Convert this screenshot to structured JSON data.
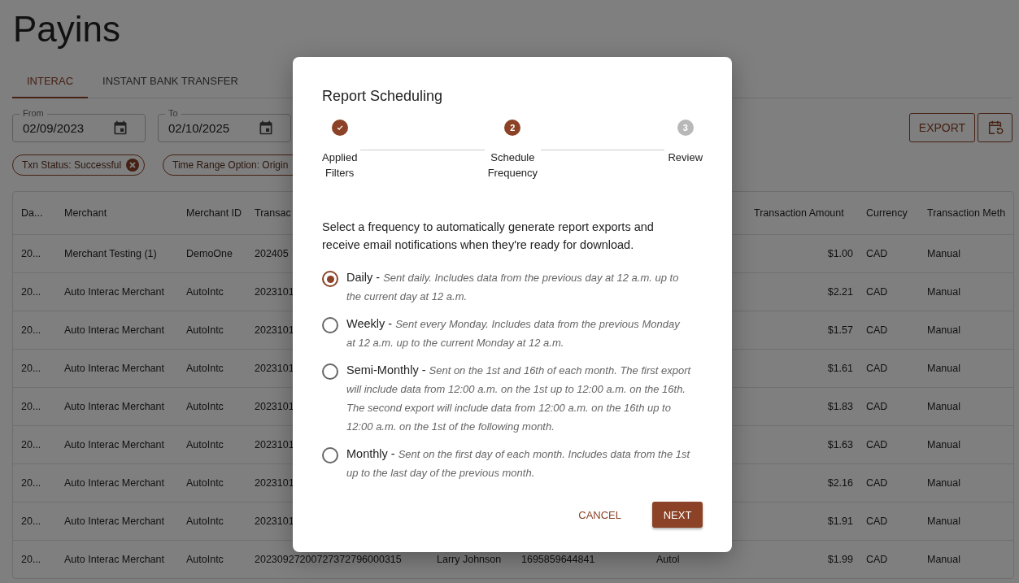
{
  "page": {
    "title": "Payins"
  },
  "tabs": [
    {
      "label": "INTERAC",
      "selected": true
    },
    {
      "label": "INSTANT BANK TRANSFER",
      "selected": false
    }
  ],
  "date_fields": [
    {
      "label": "From",
      "value": "02/09/2023"
    },
    {
      "label": "To",
      "value": "02/10/2025"
    }
  ],
  "filter_chips": [
    {
      "label": "Txn Status: Successful",
      "removable": true
    },
    {
      "label": "Time Range Option: Origin",
      "removable": false
    }
  ],
  "toolbar": {
    "export_button": "EXPORT"
  },
  "table": {
    "columns": [
      "Da...",
      "Merchant",
      "Merchant ID",
      "Transac",
      "",
      "",
      "",
      "Transaction Amount",
      "Currency",
      "Transaction Meth"
    ],
    "rows": [
      [
        "20...",
        "Merchant Testing (1)",
        "DemoOne",
        "202405",
        "",
        "",
        "",
        "$1.00",
        "CAD",
        "Manual"
      ],
      [
        "20...",
        "Auto Interac Merchant",
        "AutoIntc",
        "2023101",
        "",
        "",
        "",
        "$2.21",
        "CAD",
        "Manual"
      ],
      [
        "20...",
        "Auto Interac Merchant",
        "AutoIntc",
        "2023101",
        "",
        "",
        "",
        "$1.57",
        "CAD",
        "Manual"
      ],
      [
        "20...",
        "Auto Interac Merchant",
        "AutoIntc",
        "2023101",
        "",
        "",
        "",
        "$1.61",
        "CAD",
        "Manual"
      ],
      [
        "20...",
        "Auto Interac Merchant",
        "AutoIntc",
        "2023101",
        "",
        "",
        "",
        "$1.83",
        "CAD",
        "Manual"
      ],
      [
        "20...",
        "Auto Interac Merchant",
        "AutoIntc",
        "2023101",
        "",
        "",
        "",
        "$1.63",
        "CAD",
        "Manual"
      ],
      [
        "20...",
        "Auto Interac Merchant",
        "AutoIntc",
        "2023101",
        "",
        "",
        "",
        "$2.16",
        "CAD",
        "Manual"
      ],
      [
        "20...",
        "Auto Interac Merchant",
        "AutoIntc",
        "2023101",
        "",
        "",
        "",
        "$1.91",
        "CAD",
        "Manual"
      ],
      [
        "20...",
        "Auto Interac Merchant",
        "AutoIntc",
        "20230927200727372796000315",
        "Larry Johnson",
        "1695859644841",
        "Autol",
        "$1.99",
        "CAD",
        "Manual"
      ]
    ]
  },
  "dialog": {
    "title": "Report Scheduling",
    "steps": [
      {
        "label": "Applied Filters",
        "kind": "done"
      },
      {
        "label": "Schedule Frequency",
        "number": "2",
        "kind": "current"
      },
      {
        "label": "Review",
        "number": "3",
        "kind": "upcoming"
      }
    ],
    "description": "Select a frequency to automatically generate report exports and receive email notifications when they're ready for download.",
    "options": [
      {
        "text": "Daily - *Sent daily. Includes data from the previous day at 12 a.m. up to the current day at 12 a.m.*",
        "selected": true
      },
      {
        "text": "Weekly - *Sent every Monday. Includes data from the previous Monday at 12 a.m. up to the current Monday at 12 a.m.*",
        "selected": false
      },
      {
        "text": "Semi-Monthly - *Sent on the 1st and 16th of each month. The first export will include data from 12:00 a.m. on the 1st up to 12:00 a.m. on the 16th. The second export will include data from 12:00 a.m. on the 16th up to 12:00 a.m. on the 1st of the following month.*",
        "selected": false
      },
      {
        "text": "Monthly - *Sent on the first day of each month. Includes data from the 1st up to the last day of the previous month.*",
        "selected": false
      }
    ],
    "buttons": {
      "cancel": "CANCEL",
      "next": "NEXT"
    }
  }
}
